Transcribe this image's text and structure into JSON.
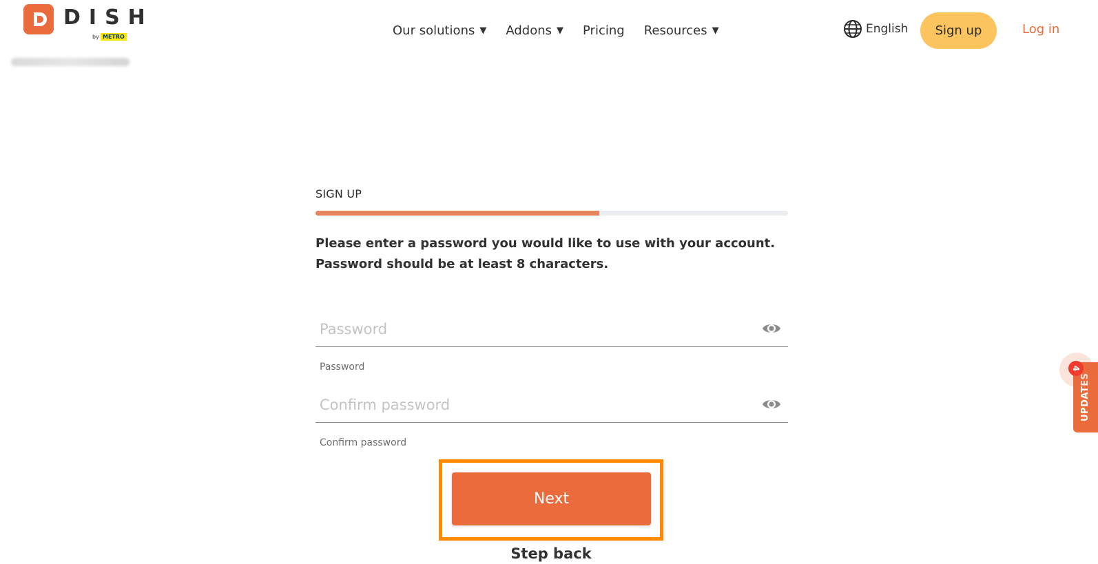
{
  "brand": {
    "name": "DISH",
    "by": "by",
    "metro": "METRO",
    "accent_color": "#ea6b3c",
    "signup_color": "#fcc45e"
  },
  "nav": {
    "items": [
      {
        "label": "Our solutions",
        "dropdown": true
      },
      {
        "label": "Addons",
        "dropdown": true
      },
      {
        "label": "Pricing",
        "dropdown": false
      },
      {
        "label": "Resources",
        "dropdown": true
      }
    ],
    "caret": "▼",
    "language": "English",
    "signup": "Sign up",
    "login": "Log in"
  },
  "form": {
    "title": "SIGN UP",
    "progress": 0.6,
    "instruction": "Please enter a password you would like to use with your account. Password should be at least 8 characters.",
    "password": {
      "placeholder": "Password",
      "value": "",
      "helper": "Password"
    },
    "confirm": {
      "placeholder": "Confirm password",
      "value": "",
      "helper": "Confirm password"
    },
    "next": "Next",
    "step_back": "Step back"
  },
  "updates": {
    "label": "UPDATES",
    "count": "4"
  }
}
